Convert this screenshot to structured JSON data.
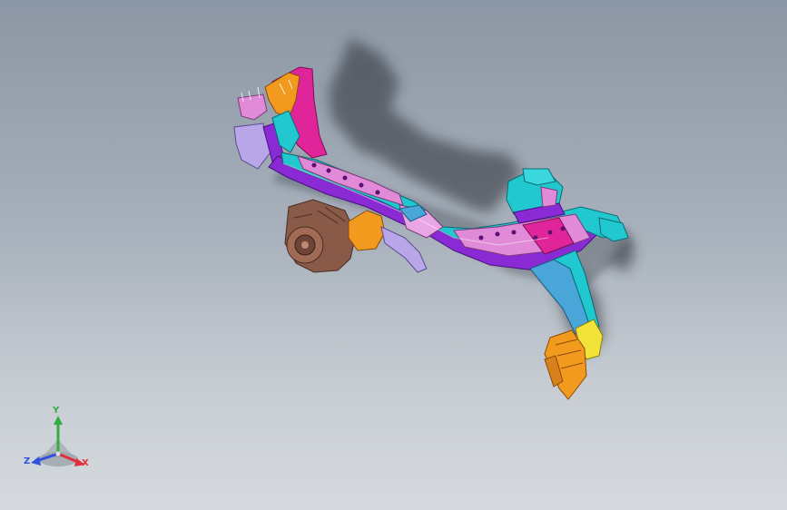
{
  "viewport": {
    "background_top": "#8c97a5",
    "background_bottom": "#d6dade"
  },
  "model": {
    "part_colors": {
      "magenta": "#e0259a",
      "purple": "#8a2ad4",
      "cyan": "#22c8cf",
      "pink": "#e08ad8",
      "orange": "#f29a1e",
      "brown": "#8a5a48",
      "yellow": "#f2e23a",
      "steel_blue": "#4aa6d8",
      "lavender": "#b9a6e8"
    },
    "shadow_color": "#2a2e36"
  },
  "triad": {
    "x_label": "X",
    "y_label": "Y",
    "z_label": "Z",
    "x_color": "#e0303a",
    "y_color": "#30b040",
    "z_color": "#3050e0"
  }
}
